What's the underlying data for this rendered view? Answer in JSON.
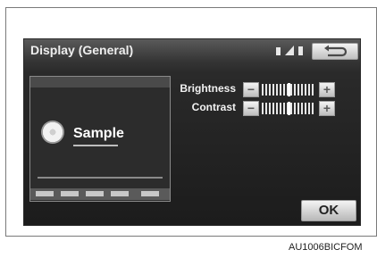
{
  "screen": {
    "title": "Display (General)",
    "status_icons": [
      "battery-icon",
      "signal-icon",
      "phone-icon"
    ],
    "back_icon": "back-arrow-icon"
  },
  "preview": {
    "sample_text": "Sample",
    "cd_icon": "cd-icon"
  },
  "settings": [
    {
      "label": "Brightness",
      "decrease_label": "−",
      "increase_label": "+"
    },
    {
      "label": "Contrast",
      "decrease_label": "−",
      "increase_label": "+"
    }
  ],
  "ok_label": "OK",
  "figure_code": "AU1006BICFOM"
}
